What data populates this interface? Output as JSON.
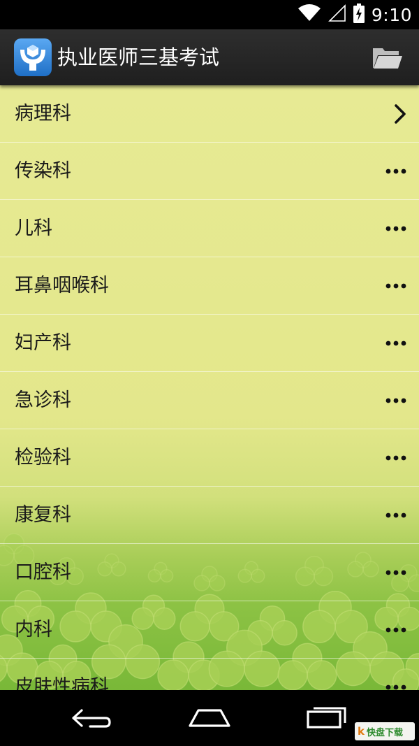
{
  "status_bar": {
    "time": "9:10",
    "icons": [
      "wifi-icon",
      "cell-signal-icon",
      "battery-charging-icon"
    ]
  },
  "action_bar": {
    "app_icon": "app-logo-icon",
    "title": "执业医师三基考试",
    "folder_icon": "folder-open-icon"
  },
  "list": {
    "items": [
      {
        "label": "病理科",
        "indicator": "chevron-right-icon"
      },
      {
        "label": "传染科",
        "indicator": "more-dots-icon"
      },
      {
        "label": "儿科",
        "indicator": "more-dots-icon"
      },
      {
        "label": "耳鼻咽喉科",
        "indicator": "more-dots-icon"
      },
      {
        "label": "妇产科",
        "indicator": "more-dots-icon"
      },
      {
        "label": "急诊科",
        "indicator": "more-dots-icon"
      },
      {
        "label": "检验科",
        "indicator": "more-dots-icon"
      },
      {
        "label": "康复科",
        "indicator": "more-dots-icon"
      },
      {
        "label": "口腔科",
        "indicator": "more-dots-icon"
      },
      {
        "label": "内科",
        "indicator": "more-dots-icon"
      },
      {
        "label": "皮肤性病科",
        "indicator": "more-dots-icon"
      }
    ]
  },
  "nav_bar": {
    "icons": [
      "back-icon",
      "home-icon",
      "recent-apps-icon"
    ]
  },
  "watermark": {
    "mark": "k",
    "text": "快盘下载"
  },
  "colors": {
    "list_background": "#e5e98f",
    "action_bar": "#262626",
    "clover_green": "#a7cf55"
  }
}
